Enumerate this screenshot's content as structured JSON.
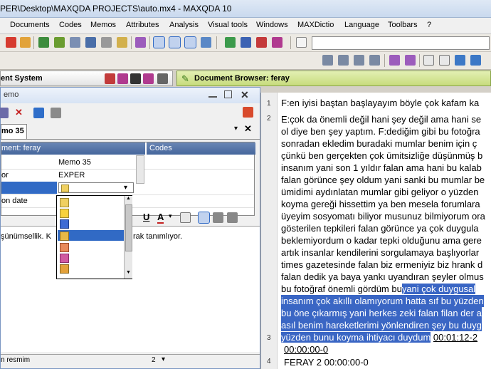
{
  "window": {
    "title": "PER\\Desktop\\MAXQDA PROJECTS\\auto.mx4 - MAXQDA 10"
  },
  "menu": [
    "Documents",
    "Codes",
    "Memos",
    "Attributes",
    "Analysis",
    "Visual tools",
    "Windows",
    "MAXDictio",
    "Language",
    "Toolbars",
    "?"
  ],
  "left_panel": {
    "header": "ent System"
  },
  "memo": {
    "window_title": "emo",
    "tab_label": "mo 35",
    "grid_header_left": "ment: feray",
    "grid_header_codes": "Codes",
    "rows": [
      {
        "label": "",
        "value": "Memo 35"
      },
      {
        "label": "or",
        "value": "EXPER"
      },
      {
        "label": "",
        "value": ""
      },
      {
        "label": "on date",
        "value": ""
      }
    ],
    "body_text": "şünümsellik. K",
    "body_text_tail": "rak tanımlıyor.",
    "footer_label": "n resmim",
    "footer_value": "2"
  },
  "right_panel": {
    "header": "Document Browser: feray"
  },
  "document": {
    "paragraph_numbers": [
      "1",
      "2",
      "3",
      "4"
    ],
    "lines": [
      "F:en iyisi baştan başlayayım böyle çok kafam ka",
      "E:çok da önemli değil hani şey değil ama hani se",
      "ol diye ben şey yaptım. F:dediğim gibi bu fotoğra",
      "sonradan ekledim buradaki mumlar benim için ç",
      "çünkü ben gerçekten çok ümitsizliğe düşünmüş b",
      "insanım yani son 1 yıldır falan ama hani bu kalab",
      "falan görünce şey oldum yani sanki bu mumlar be",
      "ümidimi aydınlatan mumlar gibi geliyor o yüzden",
      "koyma gereği hissettim ya ben mesela forumlara",
      "üyeyim sosyomatı biliyor musunuz bilmiyorum ora",
      "gösterilen tepkileri falan görünce ya çok duygula",
      "beklemiyordum o kadar tepki olduğunu ama gere",
      "artık insanlar kendilerini sorgulamaya başlıyorlar",
      "times gazetesinde falan biz ermeniyiz biz hrank d",
      "falan dedik ya baya yankı uyandıran şeyler olmus",
      "bu fotoğraf önemli gördüm bu"
    ],
    "highlight_head": "yani çok duygusal",
    "highlighted_lines": [
      "insanım çok akıllı olamıyorum hatta sıf bu yüzden",
      "bu öne çıkarmış yani herkes zeki falan filan der a",
      "asıl benim hareketlerimi yönlendiren şey bu duyg"
    ],
    "highlight_last": "yüzden bunu koyma ihtiyacı duydum",
    "timestamp1": "00:01:12-2",
    "timestamp2": "00:00:00-0",
    "heading": "FERAY 2 00:00:00-0"
  }
}
